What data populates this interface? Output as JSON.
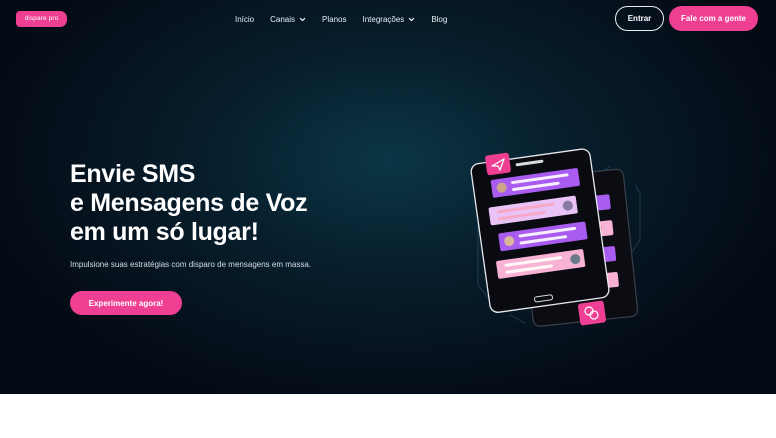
{
  "nav": {
    "logo_text": "dispare pro",
    "items": [
      {
        "label": "Início",
        "has_dropdown": false
      },
      {
        "label": "Canais",
        "has_dropdown": true
      },
      {
        "label": "Planos",
        "has_dropdown": false
      },
      {
        "label": "Integrações",
        "has_dropdown": true
      },
      {
        "label": "Blog",
        "has_dropdown": false
      }
    ],
    "login_label": "Entrar",
    "contact_label": "Fale com a gente"
  },
  "hero": {
    "headline_lines": [
      "Envie SMS",
      "e Mensagens de Voz",
      "em um só lugar!"
    ],
    "subtitle": "Impulsione suas estratégias com disparo de mensagens em massa.",
    "cta_label": "Experimente agora!"
  },
  "colors": {
    "brand_pink": "#ee3f93",
    "hero_bg": "#071d2b",
    "chat_purple": "#a95cf0",
    "chat_light_purple": "#e9c3f5",
    "chat_pink": "#f8b3d4"
  },
  "icons": {
    "dropdown": "chevron-down-icon",
    "send": "paper-plane-icon",
    "chat": "chat-bubble-icon"
  }
}
